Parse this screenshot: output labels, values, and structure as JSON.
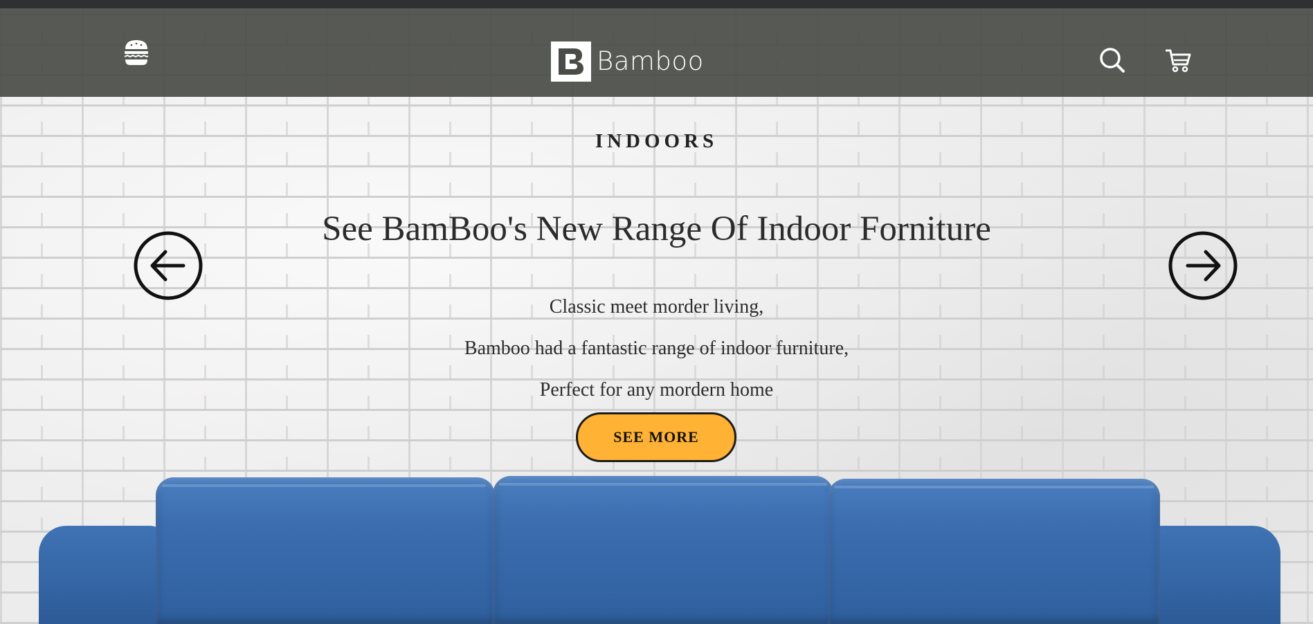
{
  "brand": {
    "name": "Bamboo",
    "logo_letter": "B"
  },
  "header": {
    "menu_icon": "hamburger-icon",
    "search_icon": "search-icon",
    "cart_icon": "cart-icon"
  },
  "hero": {
    "kicker": "INDOORS",
    "headline": "See BamBoo's New Range Of Indoor Forniture",
    "lines": [
      "Classic meet morder living,",
      "Bamboo had a fantastic range of indoor furniture,",
      "Perfect for any mordern home"
    ],
    "cta_label": "SEE MORE",
    "prev_icon": "arrow-left-icon",
    "next_icon": "arrow-right-icon"
  },
  "colors": {
    "header_bg": "#4a4c48",
    "cta_bg": "#ffb233",
    "sofa": "#3c6eb0",
    "wall": "#efeeee"
  }
}
